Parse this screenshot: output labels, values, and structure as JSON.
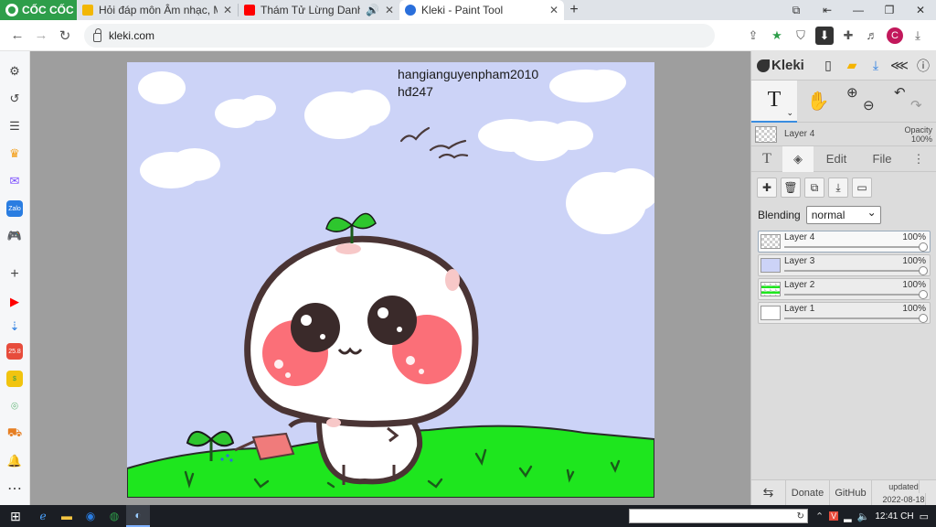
{
  "browser": {
    "brand": "CỐC CỐC",
    "tabs": [
      {
        "title": "Hỏi đáp môn Âm nhạc, Mỹ thuật",
        "favicon_color": "#f2b705",
        "active": false
      },
      {
        "title": "Thám Tử Lừng Danh Conan",
        "favicon_color": "#ff0000",
        "active": false
      },
      {
        "title": "Kleki - Paint Tool",
        "favicon_color": "#2a6fdb",
        "active": true
      }
    ],
    "url": "kleki.com",
    "profile_initial": "C"
  },
  "canvas": {
    "text_lines": [
      "hangianguyenpham2010",
      "hđ247"
    ],
    "sky_color": "#ccd3f7",
    "grass_color": "#1ee61e"
  },
  "panel": {
    "brand": "Kleki",
    "active_tool_glyph": "T",
    "current_layer": {
      "name": "Layer 4",
      "opacity_label": "Opacity",
      "opacity_value": "100%"
    },
    "tabs": [
      "Edit",
      "File"
    ],
    "blending_label": "Blending",
    "blending_value": "normal",
    "layers": [
      {
        "name": "Layer 4",
        "opacity": "100%",
        "selected": true
      },
      {
        "name": "Layer 3",
        "opacity": "100%",
        "selected": false
      },
      {
        "name": "Layer 2",
        "opacity": "100%",
        "selected": false
      },
      {
        "name": "Layer 1",
        "opacity": "100%",
        "selected": false
      }
    ],
    "footer": {
      "donate": "Donate",
      "github": "GitHub",
      "updated_label": "updated",
      "updated_date": "2022-08-18"
    }
  },
  "taskbar": {
    "time": "12:41 CH"
  }
}
